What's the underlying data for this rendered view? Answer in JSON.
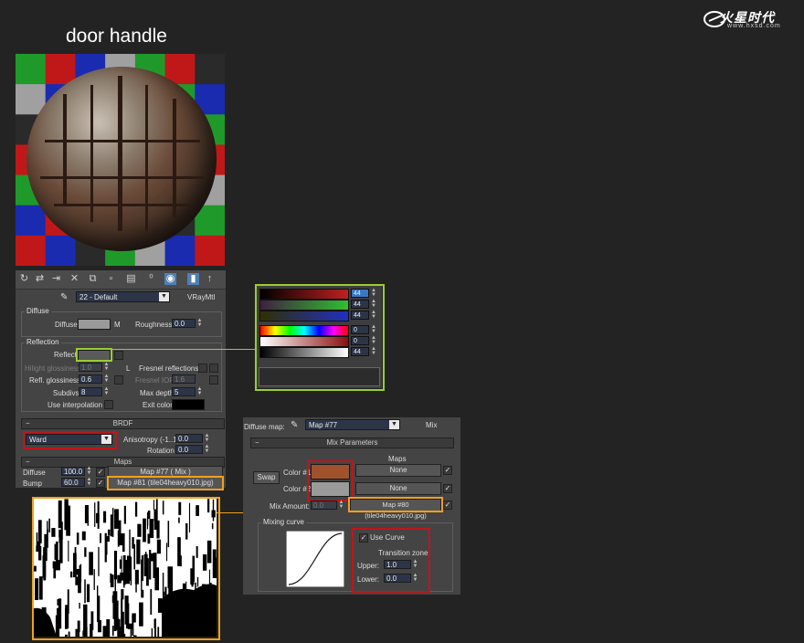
{
  "title": "door handle",
  "logo": {
    "text": "火星时代",
    "url": "www.hxsd.com"
  },
  "material": {
    "name": "22 - Default",
    "type": "VRayMtl",
    "diffuse": {
      "group": "Diffuse",
      "label": "Diffuse",
      "map_btn": "M",
      "roughness_label": "Roughness",
      "roughness": "0.0"
    },
    "reflection": {
      "group": "Reflection",
      "reflect_label": "Reflect",
      "hilight_label": "Hilight glossiness",
      "hilight_value": "1.0",
      "lock": "L",
      "fresnel_label": "Fresnel reflections",
      "refl_gloss_label": "Refl. glossiness",
      "refl_gloss": "0.6",
      "fresnel_ior_label": "Fresnel IOR",
      "fresnel_ior": "1.6",
      "subdivs_label": "Subdivs",
      "subdivs": "8",
      "max_depth_label": "Max depth",
      "max_depth": "5",
      "interp_label": "Use interpolation",
      "exit_label": "Exit color"
    },
    "brdf": {
      "rollout": "BRDF",
      "type": "Ward",
      "aniso_label": "Anisotropy (-1..1)",
      "aniso": "0.0",
      "rotation_label": "Rotation",
      "rotation": "0.0"
    },
    "maps": {
      "rollout": "Maps",
      "rows": [
        {
          "name": "Diffuse",
          "amount": "100.0",
          "map": "Map #77  ( Mix )"
        },
        {
          "name": "Bump",
          "amount": "60.0",
          "map": "Map #81 (tile04heavy010.jpg)"
        }
      ]
    }
  },
  "color_picker": {
    "values": [
      "44",
      "44",
      "44",
      "0",
      "0",
      "44"
    ]
  },
  "mix": {
    "diffuse_map_label": "Diffuse map:",
    "map_name": "Map #77",
    "map_type": "Mix",
    "rollout": "Mix Parameters",
    "maps_header": "Maps",
    "swap": "Swap",
    "color1_label": "Color #1",
    "color2_label": "Color #2",
    "color1_map": "None",
    "color2_map": "None",
    "amount_label": "Mix Amount:",
    "amount": "0.0",
    "amount_map": "Map #80 (tile04heavy010.jpg)",
    "curve_group": "Mixing curve",
    "use_curve": "Use Curve",
    "transition_label": "Transition zone:",
    "upper_label": "Upper:",
    "upper": "1.0",
    "lower_label": "Lower:",
    "lower": "0.0"
  },
  "colors": {
    "diffuse_swatch": "#9a9a9a",
    "color1": "#a0522d",
    "color2": "#9a9a9a",
    "highlight_red": "#c0151a",
    "highlight_green": "#9acd32",
    "highlight_orange": "#f0a020"
  }
}
